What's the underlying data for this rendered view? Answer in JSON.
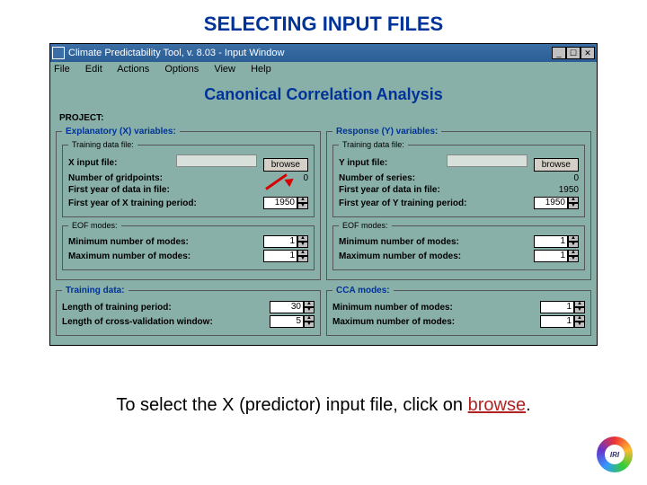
{
  "slide": {
    "title": "SELECTING INPUT FILES"
  },
  "window": {
    "title": "Climate Predictability Tool, v. 8.03 - Input Window",
    "min": "_",
    "max": "☐",
    "close": "✕"
  },
  "menu": {
    "file": "File",
    "edit": "Edit",
    "actions": "Actions",
    "options": "Options",
    "view": "View",
    "help": "Help"
  },
  "main": {
    "heading": "Canonical Correlation Analysis",
    "project_label": "PROJECT:"
  },
  "x": {
    "legend": "Explanatory (X) variables:",
    "training_legend": "Training data file:",
    "input_label": "X input file:",
    "browse": "browse",
    "gridpoints_label": "Number of gridpoints:",
    "gridpoints_value": "0",
    "firstyear_file_label": "First year of data in file:",
    "firstyear_train_label": "First year of X training period:",
    "firstyear_train_value": "1950",
    "eof_legend": "EOF modes:",
    "min_modes_label": "Minimum number of modes:",
    "min_modes_value": "1",
    "max_modes_label": "Maximum number of modes:",
    "max_modes_value": "1"
  },
  "y": {
    "legend": "Response (Y) variables:",
    "training_legend": "Training data file:",
    "input_label": "Y input file:",
    "browse": "browse",
    "series_label": "Number of series:",
    "series_value": "0",
    "firstyear_file_label": "First year of data in file:",
    "firstyear_file_value": "1950",
    "firstyear_train_label": "First year of Y training period:",
    "firstyear_train_value": "1950",
    "eof_legend": "EOF modes:",
    "min_modes_label": "Minimum number of modes:",
    "min_modes_value": "1",
    "max_modes_label": "Maximum number of modes:",
    "max_modes_value": "1"
  },
  "training": {
    "legend": "Training data:",
    "length_label": "Length of training period:",
    "length_value": "30",
    "cv_label": "Length of cross-validation window:",
    "cv_value": "5"
  },
  "cca": {
    "legend": "CCA modes:",
    "min_label": "Minimum number of modes:",
    "min_value": "1",
    "max_label": "Maximum number of modes:",
    "max_value": "1"
  },
  "caption": {
    "pre": "To select the X (predictor) input file, click on ",
    "hl": "browse",
    "post": "."
  },
  "logo": {
    "text": "IRI"
  }
}
